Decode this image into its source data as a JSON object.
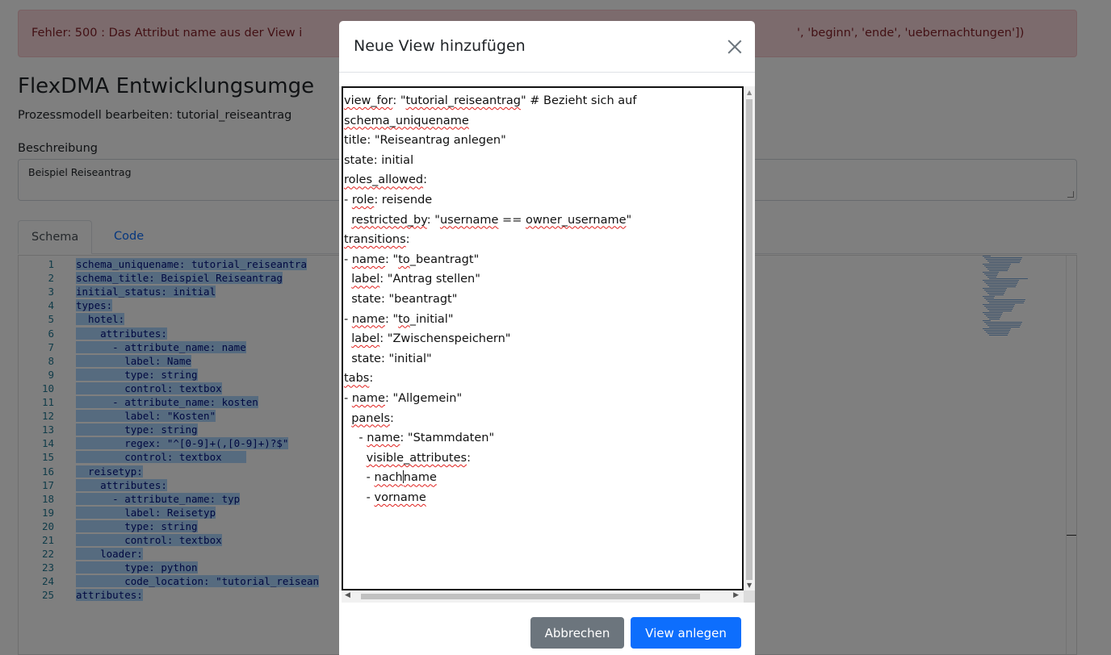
{
  "alert": {
    "text_left": "Fehler: 500 : Das Attribut name aus der View i",
    "text_right": "', 'beginn', 'ende', 'uebernachtungen'])"
  },
  "app": {
    "title": "FlexDMA Entwicklungsumge",
    "subtitle": "Prozessmodell bearbeiten: tutorial_reiseantrag"
  },
  "description": {
    "label": "Beschreibung",
    "value": "Beispiel Reiseantrag"
  },
  "tabs": [
    {
      "label": "Schema",
      "active": true
    },
    {
      "label": "Code",
      "active": false
    }
  ],
  "editor": {
    "lines": [
      {
        "n": "1",
        "text": "schema_uniquename: tutorial_reiseantra"
      },
      {
        "n": "2",
        "text": "schema_title: Beispiel Reiseantrag"
      },
      {
        "n": "3",
        "text": "initial_status: initial"
      },
      {
        "n": "4",
        "text": "types:"
      },
      {
        "n": "5",
        "text": "  hotel:"
      },
      {
        "n": "6",
        "text": "    attributes:"
      },
      {
        "n": "7",
        "text": "      - attribute_name: name"
      },
      {
        "n": "8",
        "text": "        label: Name"
      },
      {
        "n": "9",
        "text": "        type: string"
      },
      {
        "n": "10",
        "text": "        control: textbox"
      },
      {
        "n": "11",
        "text": "      - attribute_name: kosten"
      },
      {
        "n": "12",
        "text": "        label: \"Kosten\""
      },
      {
        "n": "13",
        "text": "        type: string"
      },
      {
        "n": "14",
        "text": "        regex: \"^[0-9]+(,[0-9]+)?$\""
      },
      {
        "n": "15",
        "text": "        control: textbox    "
      },
      {
        "n": "16",
        "text": "  reisetyp:"
      },
      {
        "n": "17",
        "text": "    attributes:"
      },
      {
        "n": "18",
        "text": "      - attribute_name: typ"
      },
      {
        "n": "19",
        "text": "        label: Reisetyp"
      },
      {
        "n": "20",
        "text": "        type: string"
      },
      {
        "n": "21",
        "text": "        control: textbox"
      },
      {
        "n": "22",
        "text": "    loader:"
      },
      {
        "n": "23",
        "text": "        type: python"
      },
      {
        "n": "24",
        "text": "        code_location: \"tutorial_reisean"
      },
      {
        "n": "25",
        "text": "attributes:"
      }
    ]
  },
  "modal": {
    "title": "Neue View hinzufügen",
    "cancel_label": "Abbrechen",
    "create_label": "View anlegen",
    "textarea_lines": [
      [
        {
          "t": "view_for",
          "sp": true
        },
        {
          "t": ": \"",
          "sp": false
        },
        {
          "t": "tutorial_reiseantrag",
          "sp": true
        },
        {
          "t": "\" # Bezieht sich auf",
          "sp": false
        }
      ],
      [
        {
          "t": "schema_uniquename",
          "sp": true
        }
      ],
      [
        {
          "t": "title: \"Reiseantrag anlegen\"",
          "sp": false
        }
      ],
      [
        {
          "t": "state: initial",
          "sp": false
        }
      ],
      [
        {
          "t": "roles_allowed",
          "sp": true
        },
        {
          "t": ":",
          "sp": false
        }
      ],
      [
        {
          "t": "- ",
          "sp": false
        },
        {
          "t": "role",
          "sp": true
        },
        {
          "t": ": reisende",
          "sp": false
        }
      ],
      [
        {
          "t": "  ",
          "sp": false
        },
        {
          "t": "restricted_by",
          "sp": true
        },
        {
          "t": ": \"",
          "sp": false
        },
        {
          "t": "username",
          "sp": true
        },
        {
          "t": " == ",
          "sp": false
        },
        {
          "t": "owner_username",
          "sp": true
        },
        {
          "t": "\"",
          "sp": false
        }
      ],
      [
        {
          "t": "transitions",
          "sp": true
        },
        {
          "t": ":",
          "sp": false
        }
      ],
      [
        {
          "t": "- ",
          "sp": false
        },
        {
          "t": "name",
          "sp": true
        },
        {
          "t": ": \"",
          "sp": false
        },
        {
          "t": "to",
          "sp": true
        },
        {
          "t": "_beantragt\"",
          "sp": false
        }
      ],
      [
        {
          "t": "  ",
          "sp": false
        },
        {
          "t": "label",
          "sp": true
        },
        {
          "t": ": \"Antrag stellen\"",
          "sp": false
        }
      ],
      [
        {
          "t": "  state: \"beantragt\"",
          "sp": false
        }
      ],
      [
        {
          "t": "- ",
          "sp": false
        },
        {
          "t": "name",
          "sp": true
        },
        {
          "t": ": \"",
          "sp": false
        },
        {
          "t": "to",
          "sp": true
        },
        {
          "t": "_initial\"",
          "sp": false
        }
      ],
      [
        {
          "t": "  ",
          "sp": false
        },
        {
          "t": "label",
          "sp": true
        },
        {
          "t": ": \"Zwischenspeichern\"",
          "sp": false
        }
      ],
      [
        {
          "t": "  state: \"initial\"",
          "sp": false
        }
      ],
      [
        {
          "t": "tabs",
          "sp": true
        },
        {
          "t": ":",
          "sp": false
        }
      ],
      [
        {
          "t": "- ",
          "sp": false
        },
        {
          "t": "name",
          "sp": true
        },
        {
          "t": ": \"Allgemein\"",
          "sp": false
        }
      ],
      [
        {
          "t": "  ",
          "sp": false
        },
        {
          "t": "panels",
          "sp": true
        },
        {
          "t": ":",
          "sp": false
        }
      ],
      [
        {
          "t": "    - ",
          "sp": false
        },
        {
          "t": "name",
          "sp": true
        },
        {
          "t": ": \"Stammdaten\"",
          "sp": false
        }
      ],
      [
        {
          "t": "      ",
          "sp": false
        },
        {
          "t": "visible_attributes",
          "sp": true
        },
        {
          "t": ":",
          "sp": false
        }
      ],
      [
        {
          "t": "      - ",
          "sp": false
        },
        {
          "t": "nach",
          "sp": true
        },
        {
          "caret": true
        },
        {
          "t": "name",
          "sp": true
        }
      ],
      [
        {
          "t": "      - ",
          "sp": false
        },
        {
          "t": "vorname",
          "sp": true
        }
      ]
    ]
  },
  "colors": {
    "primary": "#0d6efd",
    "secondary": "#6c757d",
    "alert_bg": "#f8d7da",
    "alert_text": "#842029"
  }
}
